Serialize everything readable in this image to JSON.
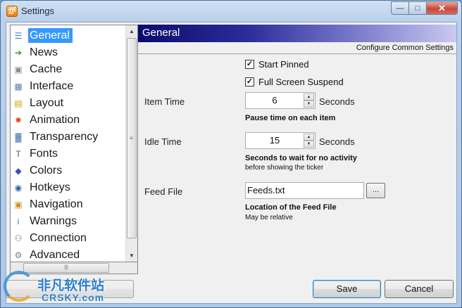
{
  "window": {
    "title": "Settings",
    "app_icon_glyph": "が"
  },
  "sidebar": {
    "items": [
      {
        "label": "General",
        "icon": "general-icon",
        "color": "#3a7bd5"
      },
      {
        "label": "News",
        "icon": "news-arrow-icon",
        "color": "#2a9a2a"
      },
      {
        "label": "Cache",
        "icon": "cache-disk-icon",
        "color": "#8a8a8a"
      },
      {
        "label": "Interface",
        "icon": "interface-icon",
        "color": "#5a7fb0"
      },
      {
        "label": "Layout",
        "icon": "layout-icon",
        "color": "#c8a000"
      },
      {
        "label": "Animation",
        "icon": "animation-icon",
        "color": "#e0502a"
      },
      {
        "label": "Transparency",
        "icon": "transparency-icon",
        "color": "#5a80c0"
      },
      {
        "label": "Fonts",
        "icon": "fonts-icon",
        "color": "#555555"
      },
      {
        "label": "Colors",
        "icon": "colors-icon",
        "color": "#3050b0"
      },
      {
        "label": "Hotkeys",
        "icon": "hotkeys-icon",
        "color": "#2f60a8"
      },
      {
        "label": "Navigation",
        "icon": "navigation-icon",
        "color": "#d09020"
      },
      {
        "label": "Warnings",
        "icon": "warnings-info-icon",
        "color": "#3a70c0"
      },
      {
        "label": "Connection",
        "icon": "connection-icon",
        "color": "#4a70a0"
      },
      {
        "label": "Advanced",
        "icon": "advanced-icon",
        "color": "#808080"
      }
    ],
    "selected": "General"
  },
  "main": {
    "banner_title": "General",
    "subheading": "Configure Common Settings",
    "start_pinned": {
      "label": "Start Pinned",
      "checked": true
    },
    "fullscreen_suspend": {
      "label": "Full Screen Suspend",
      "checked": true
    },
    "item_time": {
      "label": "Item Time",
      "value": "6",
      "unit": "Seconds",
      "hint": "Pause time on each item"
    },
    "idle_time": {
      "label": "Idle Time",
      "value": "15",
      "unit": "Seconds",
      "hint": "Seconds to wait for no activity",
      "hint2": "before showing the ticker"
    },
    "feed_file": {
      "label": "Feed File",
      "value": "Feeds.txt",
      "browse": "...",
      "hint": "Location of the Feed File",
      "hint2": "May be relative"
    }
  },
  "buttons": {
    "save": "Save",
    "cancel": "Cancel"
  },
  "watermark": {
    "text": "非凡软件站",
    "sub": "CRSKY.com"
  }
}
